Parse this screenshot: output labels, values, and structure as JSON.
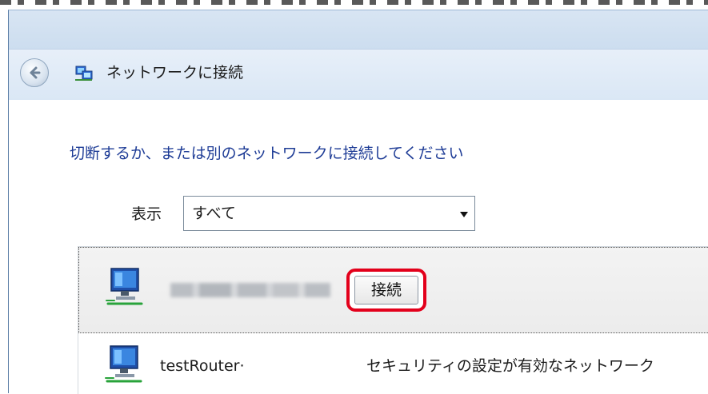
{
  "window": {
    "title": "ネットワークに接続"
  },
  "main": {
    "instruction": "切断するか、または別のネットワークに接続してください",
    "show_label": "表示",
    "show_select": {
      "selected": "すべて"
    }
  },
  "networks": [
    {
      "ssid": "",
      "ssid_obscured": true,
      "action_label": "接続",
      "icon": "network-monitor-icon"
    },
    {
      "ssid": "testRouter·",
      "status": "セキュリティの設定が有効なネットワーク",
      "icon": "network-monitor-icon"
    }
  ],
  "colors": {
    "instruction_text": "#1e3c96",
    "highlight": "#e3001b",
    "title_bar": "#c9dbee"
  }
}
